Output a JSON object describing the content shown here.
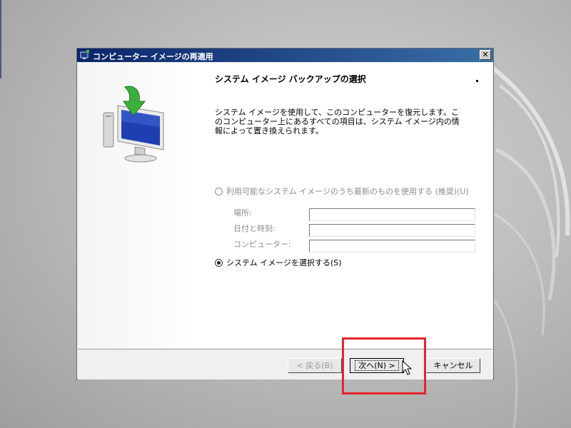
{
  "window": {
    "title": "コンピューター イメージの再適用",
    "close_glyph": "✕"
  },
  "page": {
    "heading": "システム イメージ バックアップの選択",
    "description": "システム イメージを使用して、このコンピューターを復元します。このコンピューター上にあるすべての項目は、システム イメージ内の情報によって置き換えられます。"
  },
  "options": {
    "latest": {
      "label": "利用可能なシステム イメージのうち最新のものを使用する (推奨)(U)",
      "selected": false,
      "enabled": false
    },
    "fields": {
      "location_label": "場所:",
      "datetime_label": "日付と時刻:",
      "computer_label": "コンピューター:"
    },
    "select": {
      "label": "システム イメージを選択する(S)",
      "selected": true
    }
  },
  "buttons": {
    "back": "< 戻る(B)",
    "next": "次へ(N) >",
    "cancel": "キャンセル"
  },
  "colors": {
    "titlebar_start": "#0a246a",
    "titlebar_end": "#3a6ea5",
    "highlight": "#e8232a"
  },
  "icons": {
    "window": "restore-computer-icon",
    "illustration": "computer-restore-arrow-icon",
    "cursor": "mouse-pointer-icon"
  }
}
